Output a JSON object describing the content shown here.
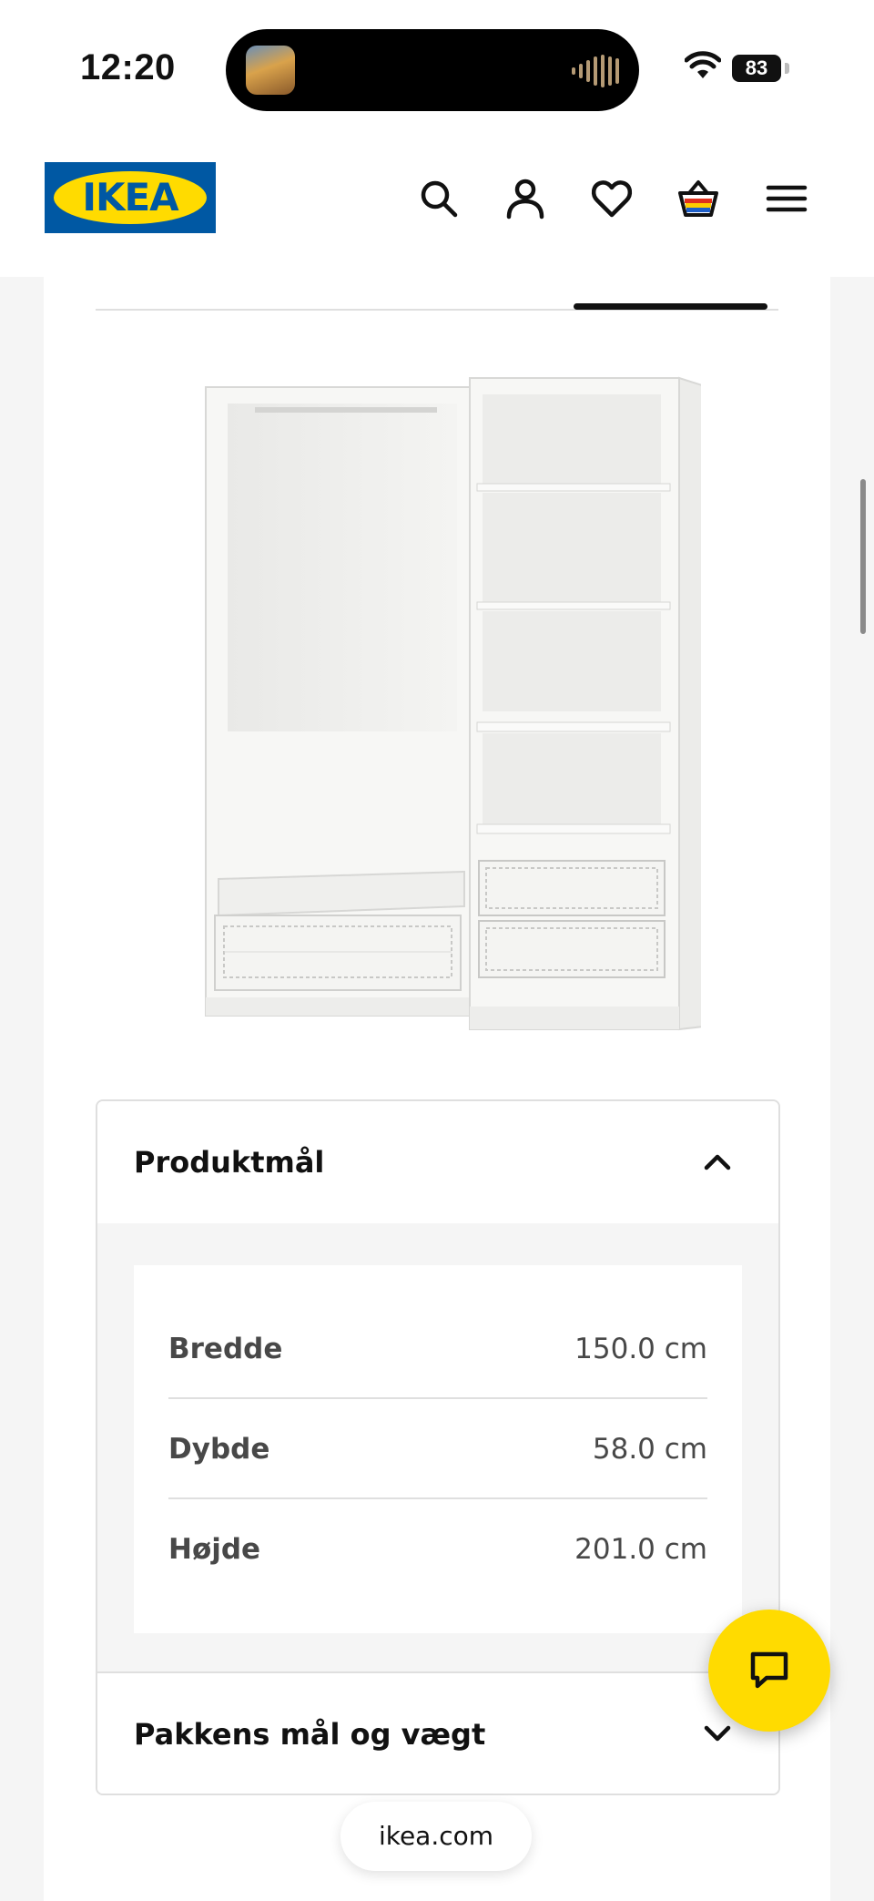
{
  "status_bar": {
    "time": "12:20",
    "battery": "83",
    "icons": [
      "now-playing-icon",
      "audio-waveform-icon",
      "wifi-icon",
      "battery-icon"
    ]
  },
  "header": {
    "logo_text": "IKEA",
    "icons": [
      "search-icon",
      "account-icon",
      "heart-icon",
      "cart-icon",
      "menu-icon"
    ]
  },
  "colors": {
    "ikea_blue": "#0058a3",
    "ikea_yellow": "#ffdb00",
    "text_primary": "#111111",
    "text_secondary": "#484848",
    "divider": "#dfdfdf",
    "page_bg": "#f5f5f5"
  },
  "product_dimensions": {
    "title": "Produktmål",
    "expanded": true,
    "rows": [
      {
        "label": "Bredde",
        "value": "150.0 cm"
      },
      {
        "label": "Dybde",
        "value": "58.0 cm"
      },
      {
        "label": "Højde",
        "value": "201.0 cm"
      }
    ]
  },
  "package_section": {
    "title": "Pakkens mål og vægt",
    "expanded": false
  },
  "chat_button": {
    "icon": "chat-icon"
  },
  "browser": {
    "url": "ikea.com"
  }
}
